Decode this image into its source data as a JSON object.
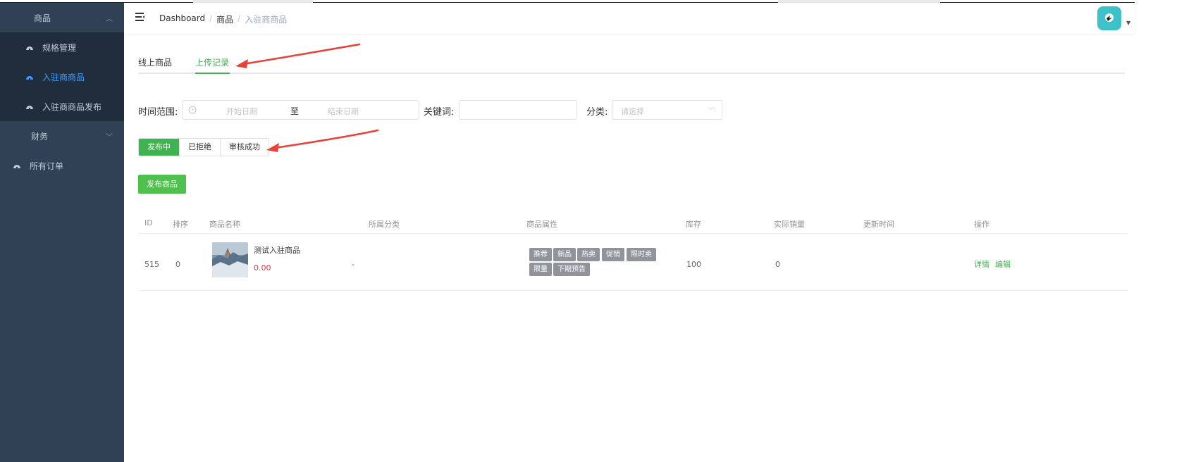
{
  "sidebar": {
    "goods_menu": "商品",
    "items": [
      {
        "label": "规格管理"
      },
      {
        "label": "入驻商商品"
      },
      {
        "label": "入驻商商品发布"
      }
    ],
    "finance_menu": "财务",
    "orders_menu": "所有订单"
  },
  "header": {
    "breadcrumb": [
      "Dashboard",
      "商品",
      "入驻商商品"
    ]
  },
  "tabs": [
    {
      "label": "线上商品",
      "active": false
    },
    {
      "label": "上传记录",
      "active": true
    }
  ],
  "filter": {
    "time_label": "时间范围:",
    "start_placeholder": "开始日期",
    "to_label": "至",
    "end_placeholder": "结束日期",
    "keyword_label": "关键词:",
    "keyword_value": "",
    "category_label": "分类:",
    "category_placeholder": "请选择"
  },
  "status_filter": [
    {
      "label": "发布中",
      "selected": true
    },
    {
      "label": "已拒绝",
      "selected": false
    },
    {
      "label": "审核成功",
      "selected": false
    }
  ],
  "publish_button": "发布商品",
  "table": {
    "headers": [
      "ID",
      "排序",
      "商品名称",
      "所属分类",
      "商品属性",
      "库存",
      "实际销量",
      "更新时间",
      "操作"
    ],
    "rows": [
      {
        "id": "515",
        "sort": "0",
        "name": "测试入驻商品",
        "price": "0.00",
        "category": "-",
        "attributes": [
          "推荐",
          "新品",
          "热卖",
          "促销",
          "限时卖",
          "限量",
          "下期预告"
        ],
        "stock": "100",
        "sales": "0",
        "updated": "",
        "actions": [
          "详情",
          "编辑"
        ]
      }
    ]
  },
  "colors": {
    "sidebar_bg": "#304156",
    "accent_green": "#3fb34f",
    "active_blue": "#409eff",
    "price_red": "#e0393e",
    "avatar_teal": "#3ec1c9"
  }
}
